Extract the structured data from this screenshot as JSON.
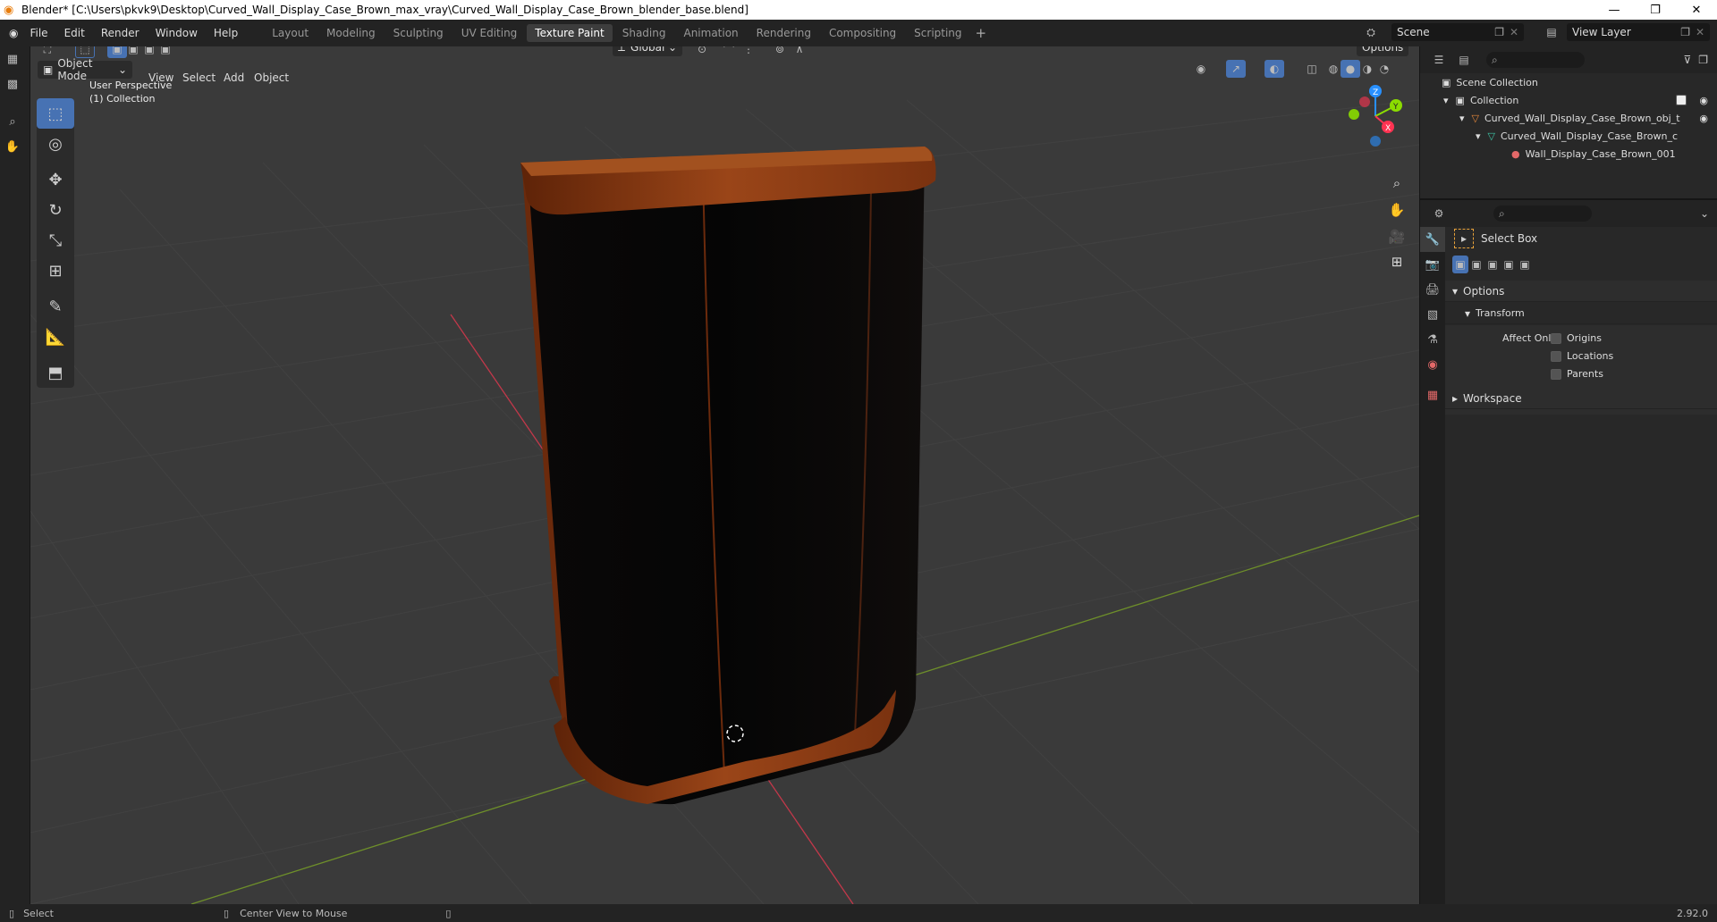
{
  "window": {
    "title": "Blender* [C:\\Users\\pkvk9\\Desktop\\Curved_Wall_Display_Case_Brown_max_vray\\Curved_Wall_Display_Case_Brown_blender_base.blend]"
  },
  "menu": {
    "file": "File",
    "edit": "Edit",
    "render": "Render",
    "window": "Window",
    "help": "Help"
  },
  "workspaces": [
    "Layout",
    "Modeling",
    "Sculpting",
    "UV Editing",
    "Texture Paint",
    "Shading",
    "Animation",
    "Rendering",
    "Compositing",
    "Scripting"
  ],
  "active_workspace": "Texture Paint",
  "scene": {
    "name": "Scene",
    "view_layer": "View Layer"
  },
  "viewport_header": {
    "mode": "Object Mode",
    "menus": [
      "View",
      "Select",
      "Add",
      "Object"
    ],
    "orientation": "Global",
    "options": "Options"
  },
  "viewport": {
    "perspective": "User Perspective",
    "collection": "(1) Collection",
    "axes": {
      "x": "X",
      "y": "Y",
      "z": "Z"
    }
  },
  "outliner": {
    "root": "Scene Collection",
    "collection": "Collection",
    "object": "Curved_Wall_Display_Case_Brown_obj_t",
    "mesh": "Curved_Wall_Display_Case_Brown_c",
    "material": "Wall_Display_Case_Brown_001"
  },
  "properties": {
    "tool_name": "Select Box",
    "options_header": "Options",
    "transform_header": "Transform",
    "affect_only": "Affect Only",
    "origins": "Origins",
    "locations": "Locations",
    "parents": "Parents",
    "workspace": "Workspace"
  },
  "status": {
    "select": "Select",
    "center": "Center View to Mouse",
    "version": "2.92.0"
  },
  "colors": {
    "accent": "#4772b3",
    "x_axis": "#ff3352",
    "y_axis": "#8bdc00",
    "z_axis": "#2890ff",
    "wood": "#8a3b12"
  }
}
